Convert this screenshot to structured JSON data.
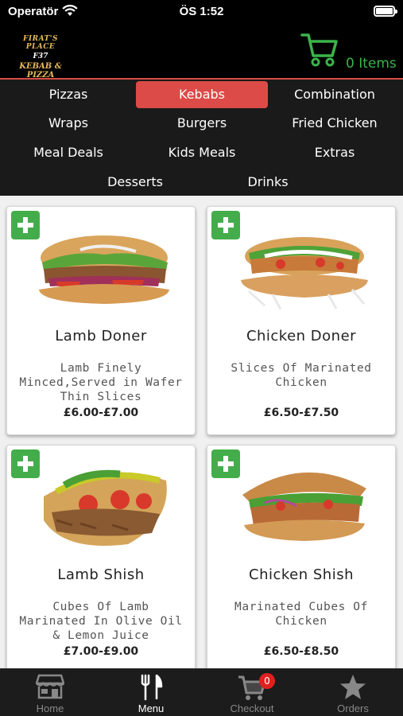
{
  "status": {
    "carrier": "Operatör",
    "time": "ÖS 1:52"
  },
  "header": {
    "logo": {
      "line1": "FIRAT'S PLACE",
      "line2": "F37",
      "line3": "KEBAB & PIZZA"
    },
    "cart_count": "0 Items",
    "accent": "#3bb44a"
  },
  "categories": [
    "Pizzas",
    "Kebabs",
    "Combination",
    "Wraps",
    "Burgers",
    "Fried Chicken",
    "Meal Deals",
    "Kids Meals",
    "Extras",
    "Desserts",
    "Drinks"
  ],
  "active_category": "Kebabs",
  "products": [
    {
      "name": "Lamb Doner",
      "description": "Lamb Finely Minced,Served in Wafer Thin Slices",
      "price": "£6.00-£7.00",
      "image": "lamb-doner-image"
    },
    {
      "name": "Chicken Doner",
      "description": "Slices Of Marinated Chicken",
      "price": "£6.50-£7.50",
      "image": "chicken-doner-image"
    },
    {
      "name": "Lamb Shish",
      "description": "Cubes Of Lamb Marinated In Olive Oil & Lemon Juice",
      "price": "£7.00-£9.00",
      "image": "lamb-shish-image"
    },
    {
      "name": "Chicken Shish",
      "description": "Marinated Cubes Of Chicken",
      "price": "£6.50-£8.50",
      "image": "chicken-shish-image"
    }
  ],
  "tabs": [
    {
      "label": "Home",
      "icon": "storefront-icon"
    },
    {
      "label": "Menu",
      "icon": "fork-knife-icon"
    },
    {
      "label": "Checkout",
      "icon": "cart-icon",
      "badge": "0"
    },
    {
      "label": "Orders",
      "icon": "star-icon"
    }
  ],
  "active_tab": "Menu",
  "colors": {
    "active_category": "#dc4b47",
    "add_button": "#44ad4b",
    "badge": "#e02020"
  }
}
